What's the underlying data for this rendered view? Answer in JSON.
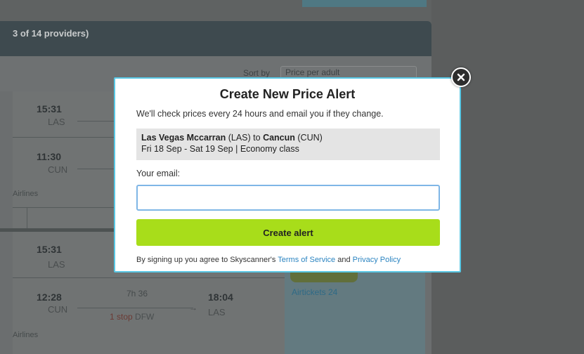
{
  "background": {
    "results_header": "3 of 14 providers)",
    "sort_label": "Sort by",
    "sort_value": "Price per adult",
    "cards": [
      {
        "out_time": "15:31",
        "out_code": "LAS",
        "ret_time": "11:30",
        "ret_code": "CUN",
        "airline": "Airlines"
      },
      {
        "out_time": "15:31",
        "out_code": "LAS",
        "ret_time": "12:28",
        "ret_code": "CUN",
        "duration": "7h 36",
        "stops": "1 stop",
        "stop_airport": "DFW",
        "arr_time": "18:04",
        "arr_code": "LAS",
        "airline": "Airlines"
      }
    ],
    "provider": "Airtickets 24"
  },
  "modal": {
    "title": "Create New Price Alert",
    "description": "We'll check prices every 24 hours and email you if they change.",
    "route": {
      "origin_name": "Las Vegas Mccarran",
      "origin_code": "(LAS)",
      "to_word": "to",
      "destination_name": "Cancun",
      "destination_code": "(CUN)",
      "dates_class": "Fri 18 Sep - Sat 19 Sep | Economy class"
    },
    "email_label": "Your email:",
    "email_value": "",
    "email_placeholder": "",
    "submit_label": "Create alert",
    "terms_prefix": "By signing up you agree to Skyscanner's",
    "terms_link": "Terms of Service",
    "terms_and": "and",
    "privacy_link": "Privacy Policy"
  },
  "icons": {
    "close": "close-icon"
  },
  "colors": {
    "accent_border": "#58c7e4",
    "button": "#a8dd1a",
    "link": "#2b84c1"
  }
}
